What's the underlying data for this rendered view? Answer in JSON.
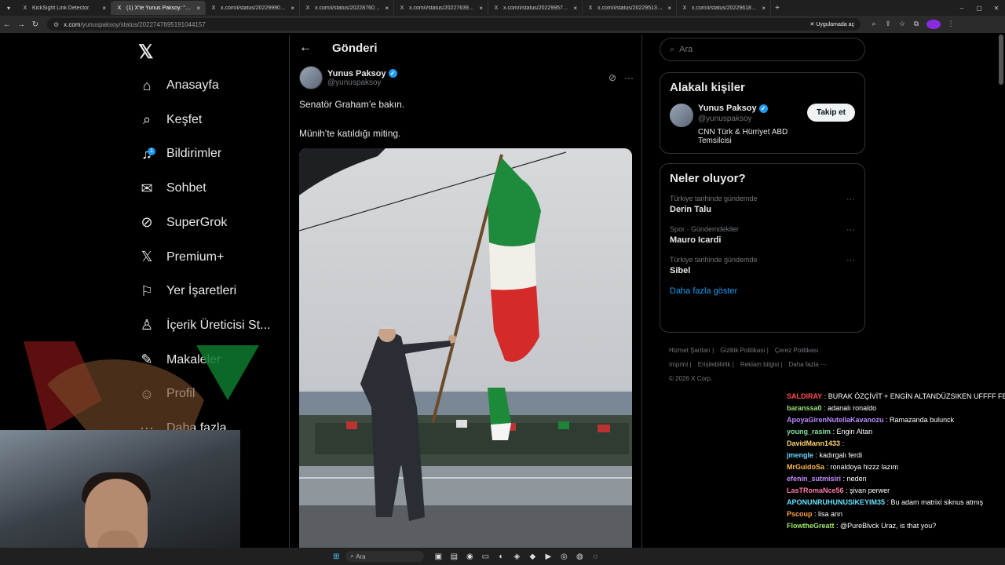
{
  "browser": {
    "tabs": [
      {
        "title": "KickSight Link Detector",
        "active": false
      },
      {
        "title": "(1) X'te Yunus Paksoy: \"Senatö...",
        "active": true
      },
      {
        "title": "x.com/i/status/2022999054054...",
        "active": false
      },
      {
        "title": "x.com/i/status/2022876019026...",
        "active": false
      },
      {
        "title": "x.com/i/status/2022763987238...",
        "active": false
      },
      {
        "title": "x.com/i/status/2022995715266...",
        "active": false
      },
      {
        "title": "x.com/i/status/2022951387858...",
        "active": false
      },
      {
        "title": "x.com/i/status/2022961898098...",
        "active": false
      }
    ],
    "url_host": "x.com",
    "url_path": "/yunuspaksoy/status/2022747695191044157",
    "app_chip": "Uygulamada aç"
  },
  "nav": {
    "items": [
      {
        "label": "Anasayfa",
        "icon": "home-icon"
      },
      {
        "label": "Keşfet",
        "icon": "search-icon"
      },
      {
        "label": "Bildirimler",
        "icon": "bell-icon",
        "badge": "1"
      },
      {
        "label": "Sohbet",
        "icon": "mail-icon"
      },
      {
        "label": "SuperGrok",
        "icon": "grok-icon"
      },
      {
        "label": "Premium+",
        "icon": "x-icon"
      },
      {
        "label": "Yer İşaretleri",
        "icon": "bookmark-icon"
      },
      {
        "label": "İçerik Üreticisi St...",
        "icon": "creator-icon"
      },
      {
        "label": "Makaleler",
        "icon": "article-icon"
      },
      {
        "label": "Profil",
        "icon": "profile-icon"
      },
      {
        "label": "Daha fazla",
        "icon": "more-icon"
      }
    ]
  },
  "post": {
    "header_title": "Gönderi",
    "author_name": "Yunus Paksoy",
    "author_handle": "@yunuspaksoy",
    "text_line1": "Senatör Graham’e bakın.",
    "text_line2": "Münih’te katıldığı miting."
  },
  "right": {
    "search_placeholder": "Ara",
    "related_title": "Alakalı kişiler",
    "related_name": "Yunus Paksoy",
    "related_handle": "@yunuspaksoy",
    "related_bio": "CNN Türk & Hürriyet ABD Temsilcisi",
    "follow_label": "Takip et",
    "trends_title": "Neler oluyor?",
    "trends": [
      {
        "category": "Türkiye tarihinde gündemde",
        "name": "Derin Talu"
      },
      {
        "category": "Spor · Gündemdekiler",
        "name": "Mauro Icardi"
      },
      {
        "category": "Türkiye tarihinde gündemde",
        "name": "Sibel"
      }
    ],
    "show_more": "Daha fazla göster",
    "footer_links": [
      "Hizmet Şartları",
      "Gizlilik Politikası",
      "Çerez Politikası",
      "Imprint",
      "Erişilebilirlik",
      "Reklam bilgisi",
      "Daha fazla ···"
    ],
    "copyright": "© 2026 X Corp."
  },
  "chat": [
    {
      "user": "SALDIRAY",
      "msg": "BURAK ÖZÇİVİT + ENGİN ALTANDÜZSIKEN UFFFF FECİ PR",
      "color": "#ff4d4d"
    },
    {
      "user": "baranssa0",
      "msg": "adanalı ronaldo",
      "color": "#9be37b"
    },
    {
      "user": "ApoyaGirenNutellaKavanozu",
      "msg": "Ramazanda bulunck",
      "color": "#b98cff"
    },
    {
      "user": "young_rasim",
      "msg": "Engin Altan",
      "color": "#7ee0a0"
    },
    {
      "user": "DavidMann1433",
      "msg": "",
      "color": "#ffd36b"
    },
    {
      "user": "jmengle",
      "msg": "kadırgalı ferdi",
      "color": "#6bd6ff"
    },
    {
      "user": "MrGuidoSa",
      "msg": "ronaldoya hizzz lazım",
      "color": "#ffb84d"
    },
    {
      "user": "efenin_sutmisiri",
      "msg": "neden",
      "color": "#c78bff"
    },
    {
      "user": "LasTRomaNce56",
      "msg": "şivan perwer",
      "color": "#ff7aa8"
    },
    {
      "user": "APONUNRUHUNUSIKEYIM35",
      "msg": "Bu adam matrixi siknus atmış",
      "color": "#63e2ff"
    },
    {
      "user": "Pscoup",
      "msg": "lisa ann",
      "color": "#ff9f43"
    },
    {
      "user": "FlowtheGreatt",
      "msg": "@PureBlvck Uraz, is that you?",
      "color": "#a0e86b"
    }
  ],
  "taskbar": {
    "search_placeholder": "Ara"
  }
}
